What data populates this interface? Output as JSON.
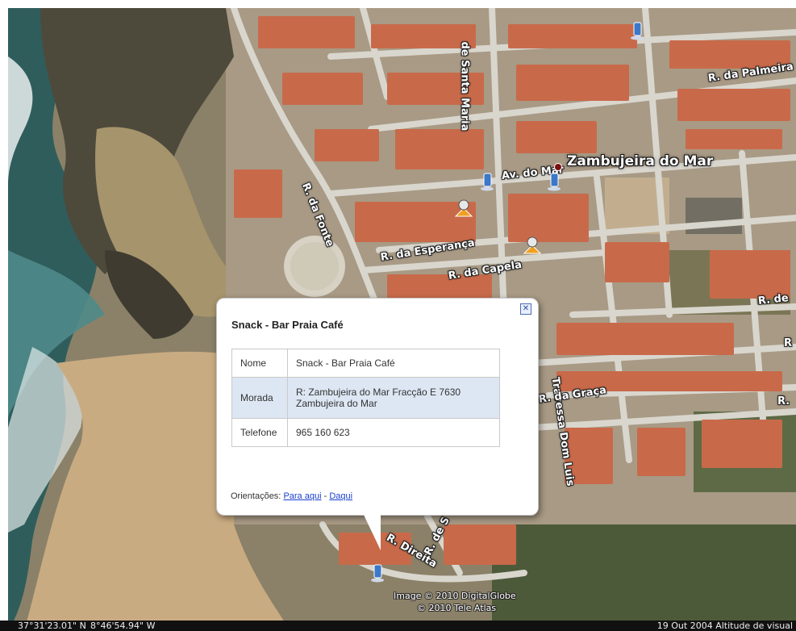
{
  "map": {
    "town": "Zambujeira do Mar",
    "roads": [
      "de Santa Maria",
      "R. da Palmeira",
      "Av. do Mar",
      "R. da Fonte",
      "R. da Esperança",
      "R. da Capela",
      "R. de",
      "R",
      "Travessa Dom Luis",
      "R. da Graça",
      "R.",
      "R. Direita",
      "R. de S"
    ],
    "credits": [
      "Image © 2010 DigitalGlobe",
      "© 2010 Tele Atlas"
    ]
  },
  "balloon": {
    "close": "✕",
    "title": "Snack - Bar Praia Café",
    "rows": [
      {
        "key": "Nome",
        "value": "Snack - Bar Praia Café"
      },
      {
        "key": "Morada",
        "value": "R: Zambujeira do Mar  Fracção E 7630 Zambujeira do Mar"
      },
      {
        "key": "Telefone",
        "value": "965 160 623"
      }
    ],
    "directions_label": "Orientações:",
    "directions_to": "Para aqui",
    "directions_sep": "-",
    "directions_from": "Daqui"
  },
  "status": {
    "lat": "37°31'23.01\" N",
    "lon": "8°46'54.94\" W",
    "right": "19 Out 2004 Altitude de visual"
  },
  "colors": {
    "link": "#1a3fcf",
    "alt_row": "#dde7f3",
    "sea": "#2e5e5e",
    "sand": "#c9ab82",
    "roof": "#c86a4a"
  }
}
